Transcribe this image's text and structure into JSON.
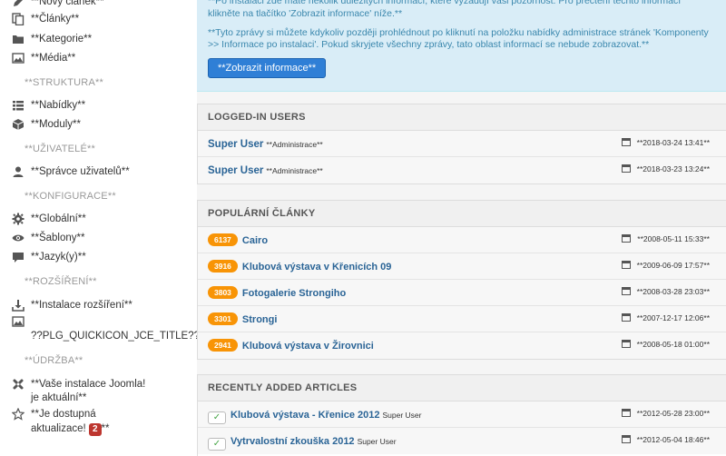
{
  "sidebar": {
    "content_items": [
      {
        "label": "**Nový článek**",
        "icon": "pencil-icon"
      },
      {
        "label": "**Články**",
        "icon": "copy-icon"
      },
      {
        "label": "**Kategorie**",
        "icon": "folder-icon"
      },
      {
        "label": "**Média**",
        "icon": "image-icon"
      }
    ],
    "structure_heading": "**STRUKTURA**",
    "structure_items": [
      {
        "label": "**Nabídky**",
        "icon": "list-icon"
      },
      {
        "label": "**Moduly**",
        "icon": "cube-icon"
      }
    ],
    "users_heading": "**UŽIVATELÉ**",
    "users_items": [
      {
        "label": "**Správce uživatelů**",
        "icon": "user-icon"
      }
    ],
    "config_heading": "**KONFIGURACE**",
    "config_items": [
      {
        "label": "**Globální**",
        "icon": "gear-icon"
      },
      {
        "label": "**Šablony**",
        "icon": "eye-icon"
      },
      {
        "label": "**Jazyk(y)**",
        "icon": "comment-icon"
      }
    ],
    "extensions_heading": "**ROZŠÍŘENÍ**",
    "extensions_items": [
      {
        "label": "**Instalace rozšíření**",
        "icon": "download-icon"
      },
      {
        "label": "??PLG_QUICKICON_JCE_TITLE??",
        "icon": "image-icon"
      }
    ],
    "maintenance_heading": "**ÚDRŽBA**",
    "maintenance_items": [
      {
        "label_line1": "**Vaše instalace Joomla!",
        "label_line2": "je aktuální**",
        "icon": "joomla-icon"
      },
      {
        "label_line1": "**Je dostupná",
        "label_line2": "aktualizace!",
        "badge": "2",
        "label_suffix": "**",
        "icon": "star-icon"
      }
    ]
  },
  "info": {
    "line1": "**Po instalaci zde máte několik důležitých informací, které vyžadují vaši pozornost. Pro přečtení těchto informací",
    "line2": "klikněte na tlačítko 'Zobrazit informace' níže.**",
    "line3": "**Tyto zprávy si můžete kdykoliv později prohlédnout po kliknutí na položku nabídky administrace stránek 'Komponenty",
    "line4": ">> Informace po instalaci'. Pokud skryjete všechny zprávy, tato oblast informací se nebude zobrazovat.**",
    "button": "**Zobrazit informace**"
  },
  "logged_in": {
    "title": "LOGGED-IN USERS",
    "rows": [
      {
        "user": "Super User",
        "role": "**Administrace**",
        "date": "**2018-03-24 13:41**"
      },
      {
        "user": "Super User",
        "role": "**Administrace**",
        "date": "**2018-03-23 13:24**"
      }
    ]
  },
  "popular": {
    "title": "POPULÁRNÍ ČLÁNKY",
    "rows": [
      {
        "hits": "6137",
        "title": "Cairo",
        "date": "**2008-05-11 15:33**"
      },
      {
        "hits": "3916",
        "title": "Klubová výstava v Křenicích 09",
        "date": "**2009-06-09 17:57**"
      },
      {
        "hits": "3803",
        "title": "Fotogalerie Strongiho",
        "date": "**2008-03-28 23:03**"
      },
      {
        "hits": "3301",
        "title": "Strongi",
        "date": "**2007-12-17 12:06**"
      },
      {
        "hits": "2941",
        "title": "Klubová výstava v Žirovnici",
        "date": "**2008-05-18 01:00**"
      }
    ]
  },
  "recent": {
    "title": "RECENTLY ADDED ARTICLES",
    "rows": [
      {
        "title": "Klubová výstava - Křenice 2012",
        "author": "Super User",
        "date": "**2012-05-28 23:00**"
      },
      {
        "title": "Vytrvalostní zkouška 2012",
        "author": "Super User",
        "date": "**2012-05-04 18:46**"
      }
    ]
  },
  "colors": {
    "accent": "#2f7fd6",
    "hits_badge": "#f89406",
    "update_badge": "#bd362f",
    "info_bg": "#d9edf7",
    "link": "#2a6496"
  }
}
